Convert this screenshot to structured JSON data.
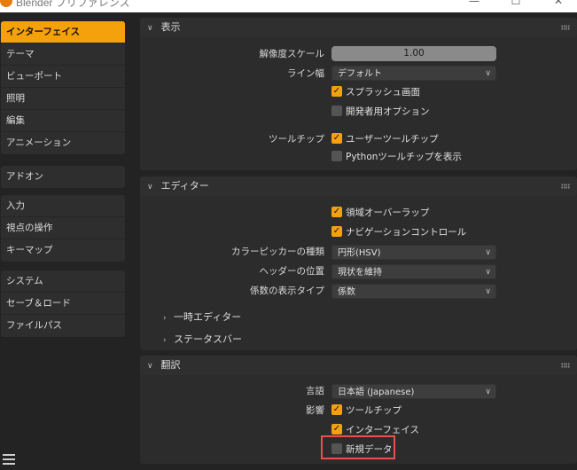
{
  "window": {
    "title": "Blender プリファレンス"
  },
  "sidebar": {
    "items": [
      "インターフェイス",
      "テーマ",
      "ビューポート",
      "照明",
      "編集",
      "アニメーション",
      "アドオン",
      "入力",
      "視点の操作",
      "キーマップ",
      "システム",
      "セーブ＆ロード",
      "ファイルパス"
    ]
  },
  "display": {
    "header": "表示",
    "resolution_scale_label": "解像度スケール",
    "resolution_scale_value": "1.00",
    "line_width_label": "ライン幅",
    "line_width_value": "デフォルト",
    "splash_label": "スプラッシュ画面",
    "splash_checked": true,
    "dev_extras_label": "開発者用オプション",
    "dev_extras_checked": false,
    "tooltips_label": "ツールチップ",
    "user_tooltips_label": "ユーザーツールチップ",
    "user_tooltips_checked": true,
    "python_tooltips_label": "Pythonツールチップを表示",
    "python_tooltips_checked": false
  },
  "editors": {
    "header": "エディター",
    "region_overlap_label": "領域オーバーラップ",
    "region_overlap_checked": true,
    "nav_controls_label": "ナビゲーションコントロール",
    "nav_controls_checked": true,
    "color_picker_label": "カラーピッカーの種類",
    "color_picker_value": "円形(HSV)",
    "header_pos_label": "ヘッダーの位置",
    "header_pos_value": "現状を維持",
    "factor_display_label": "係数の表示タイプ",
    "factor_display_value": "係数",
    "temp_editors_label": "一時エディター",
    "status_bar_label": "ステータスバー"
  },
  "translation": {
    "header": "翻訳",
    "language_label": "言語",
    "language_value": "日本語 (Japanese)",
    "affect_label": "影響",
    "tooltips_label": "ツールチップ",
    "tooltips_checked": true,
    "interface_label": "インターフェイス",
    "interface_checked": true,
    "new_data_label": "新規データ",
    "new_data_checked": false
  },
  "colors": {
    "accent": "#f5a10c",
    "highlight_box": "#e8524a"
  }
}
